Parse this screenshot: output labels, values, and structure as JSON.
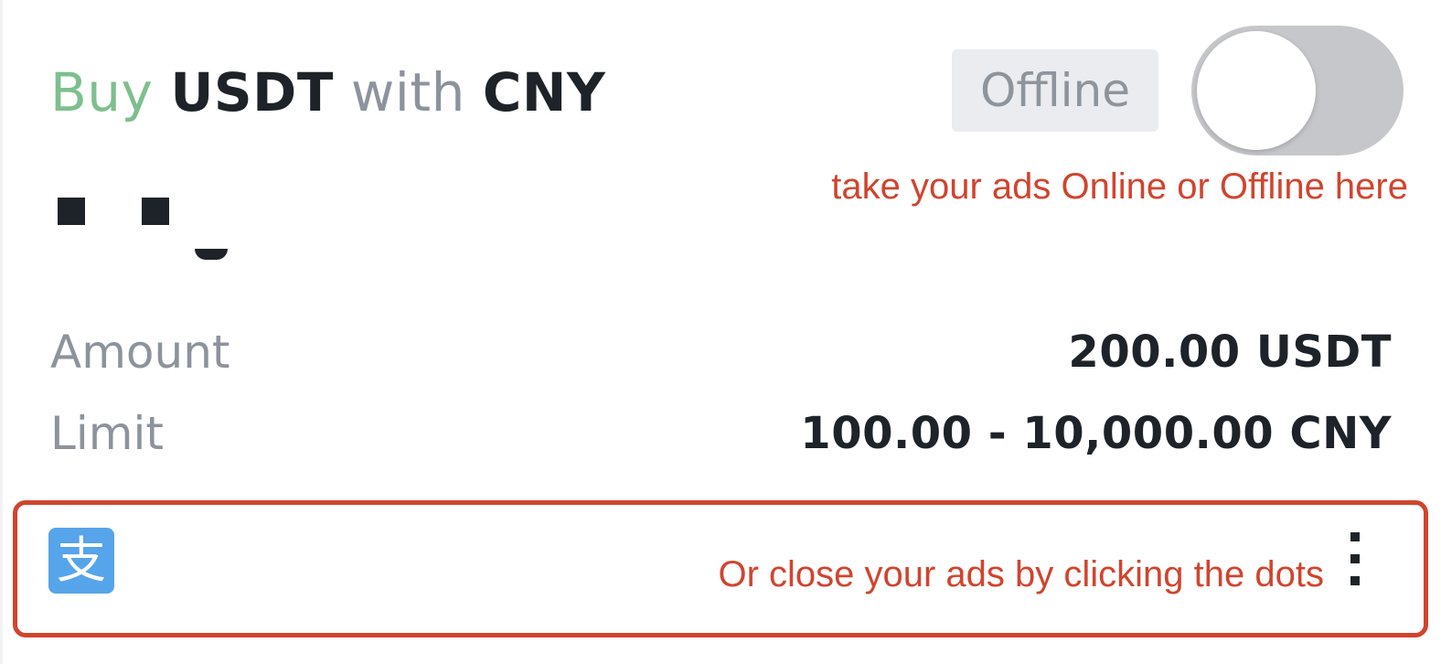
{
  "ad": {
    "title": {
      "action": "Buy",
      "asset": "USDT",
      "connector": "with",
      "fiat": "CNY"
    },
    "status_label": "Offline",
    "online_toggle": {
      "on": false
    },
    "amount_label": "Amount",
    "amount_value": "200.00 USDT",
    "limit_label": "Limit",
    "limit_value": "100.00 - 10,000.00 CNY",
    "payment_method_icon": "alipay-icon",
    "payment_method_glyph": "支"
  },
  "annotations": {
    "toggle_hint": "take your ads Online or Offline here",
    "dots_hint": "Or close your ads by clicking the dots"
  },
  "colors": {
    "buy": "#7ebf8e",
    "annotation": "#d1442e",
    "alipay": "#56a4ea",
    "toggle_off": "#c6c7ca"
  },
  "icons": {
    "more": "more-vertical-icon"
  }
}
